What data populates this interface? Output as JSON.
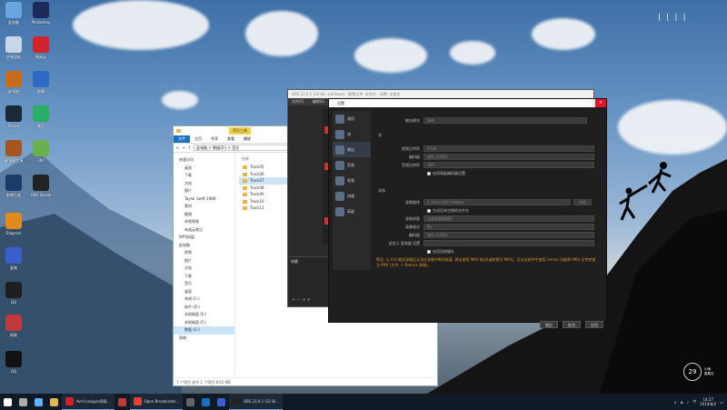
{
  "desktop_icons": [
    {
      "label": "此电脑",
      "color": "#6aa5e0"
    },
    {
      "label": "Photoshop",
      "color": "#1e2a5a"
    },
    {
      "label": "控制面板",
      "color": "#c9d6e8"
    },
    {
      "label": "网易云",
      "color": "#d0242c"
    },
    {
      "label": "gif录制",
      "color": "#c76b1c"
    },
    {
      "label": "剪辑",
      "color": "#2f6bc6"
    },
    {
      "label": "Steam",
      "color": "#1b2838"
    },
    {
      "label": "微信",
      "color": "#2aae67"
    },
    {
      "label": "gif录制工具",
      "color": "#a5561e"
    },
    {
      "label": "360",
      "color": "#6ab04c"
    },
    {
      "label": "剪辑工具",
      "color": "#1a3b66"
    },
    {
      "label": "OBS Studio",
      "color": "#222"
    },
    {
      "label": "Diagram",
      "color": "#e08a1e"
    },
    {
      "label": "复制",
      "color": "#3a5fcc"
    },
    {
      "label": "QQ",
      "color": "#1f1f1f"
    },
    {
      "label": "网易",
      "color": "#c03a3a"
    },
    {
      "label": "QQ",
      "color": "#111"
    }
  ],
  "explorer": {
    "tools_tab": "音乐工具",
    "tabs": [
      "文件",
      "主页",
      "共享",
      "查看",
      "播放"
    ],
    "path": "此电脑 > 数据(D:) > 音乐",
    "nav": [
      {
        "label": "快速访问",
        "top": true
      },
      {
        "label": "桌面"
      },
      {
        "label": "下载"
      },
      {
        "label": "文档"
      },
      {
        "label": "图片"
      },
      {
        "label": "Taylor Swift 1989"
      },
      {
        "label": "素材"
      },
      {
        "label": "截图"
      },
      {
        "label": "本地视频"
      },
      {
        "label": "有道云笔记"
      },
      {
        "label": "WPS网盘",
        "top": true
      },
      {
        "label": "此电脑",
        "top": true
      },
      {
        "label": "视频"
      },
      {
        "label": "图片"
      },
      {
        "label": "文档"
      },
      {
        "label": "下载"
      },
      {
        "label": "音乐"
      },
      {
        "label": "桌面"
      },
      {
        "label": "系统 (C:)"
      },
      {
        "label": "软件 (D:)"
      },
      {
        "label": "本地磁盘 (E:)"
      },
      {
        "label": "本地磁盘 (F:)"
      },
      {
        "label": "数据 (G:)",
        "sel": true
      },
      {
        "label": "网络",
        "top": true
      }
    ],
    "column_header": "名称",
    "files": [
      "Track05",
      "Track06",
      "Track07",
      "Track08",
      "Track09",
      "Track10",
      "Track11"
    ],
    "selected_file_index": 2,
    "status": "7 个项目   选中 1 个项目 8.01 MB"
  },
  "obs": {
    "title": "OBS 23.0.1 (32-bit, windows) - 配置文件: 未命名 - 场景: 未命名",
    "menu": [
      "文件(F)",
      "编辑(E)",
      "视图(V)"
    ],
    "panel_label": "场景"
  },
  "settings": {
    "title": "设置",
    "sidebar": [
      {
        "label": "通用"
      },
      {
        "label": "流"
      },
      {
        "label": "输出",
        "sel": true
      },
      {
        "label": "音频"
      },
      {
        "label": "视频"
      },
      {
        "label": "热键"
      },
      {
        "label": "高级"
      }
    ],
    "output_mode_label": "输出模式",
    "output_mode_value": "简单",
    "stream_section": "流",
    "video_bitrate_label": "视频比特率",
    "video_bitrate_value": "2500",
    "encoder_label": "编码器",
    "encoder_value": "软件 (x264)",
    "audio_bitrate_label": "音频比特率",
    "audio_bitrate_value": "160",
    "advanced_encoder_label": "启用高级编码器设置",
    "record_section": "录像",
    "record_path_label": "录像路径",
    "record_path_value": "C:/Users/用户/Videos",
    "browse_label": "浏览",
    "no_space_label": "生成没有空格的文件名",
    "record_quality_label": "录像质量",
    "record_quality_value": "与串流画质相同",
    "record_format_label": "录像格式",
    "record_format_value": "flv",
    "record_encoder_label": "编码器",
    "record_encoder_value": "软件 (x264)",
    "mux_label": "自定义 混流器 设置",
    "replay_label": "启用回放缓存",
    "warning": "警告: 以 FLV 格式录像后无法在录像中断时恢复, 建议使用 MKV 格式(或转换为 MP4)。可以在软件中使用 remux 功能将 MKV 文件转换为 MP4 (文件 -> Remux 录像)。",
    "ok": "确定",
    "cancel": "取消",
    "apply": "应用"
  },
  "taskbar": {
    "items": [
      {
        "label": "",
        "color": "#ffffff"
      },
      {
        "label": "",
        "color": "#aaaaaa"
      },
      {
        "label": "",
        "color": "#5db3ff"
      },
      {
        "label": "",
        "color": "#e8b450"
      },
      {
        "label": "Avril Lavigne网易...",
        "color": "#d0242c"
      },
      {
        "label": "",
        "color": "#c03a3a"
      },
      {
        "label": "Open Broadcaste...",
        "color": "#dd4433"
      },
      {
        "label": "",
        "color": "#666"
      },
      {
        "label": "",
        "color": "#1a6fc0"
      },
      {
        "label": "",
        "color": "#3a5fcc"
      },
      {
        "label": "OBS 23.0.1 (32 Bi...",
        "color": "#222222"
      }
    ],
    "time": "14:27",
    "date": "2019/8/2"
  },
  "weather": {
    "temp": "29",
    "line1": "小雨",
    "line2": "星期五"
  }
}
